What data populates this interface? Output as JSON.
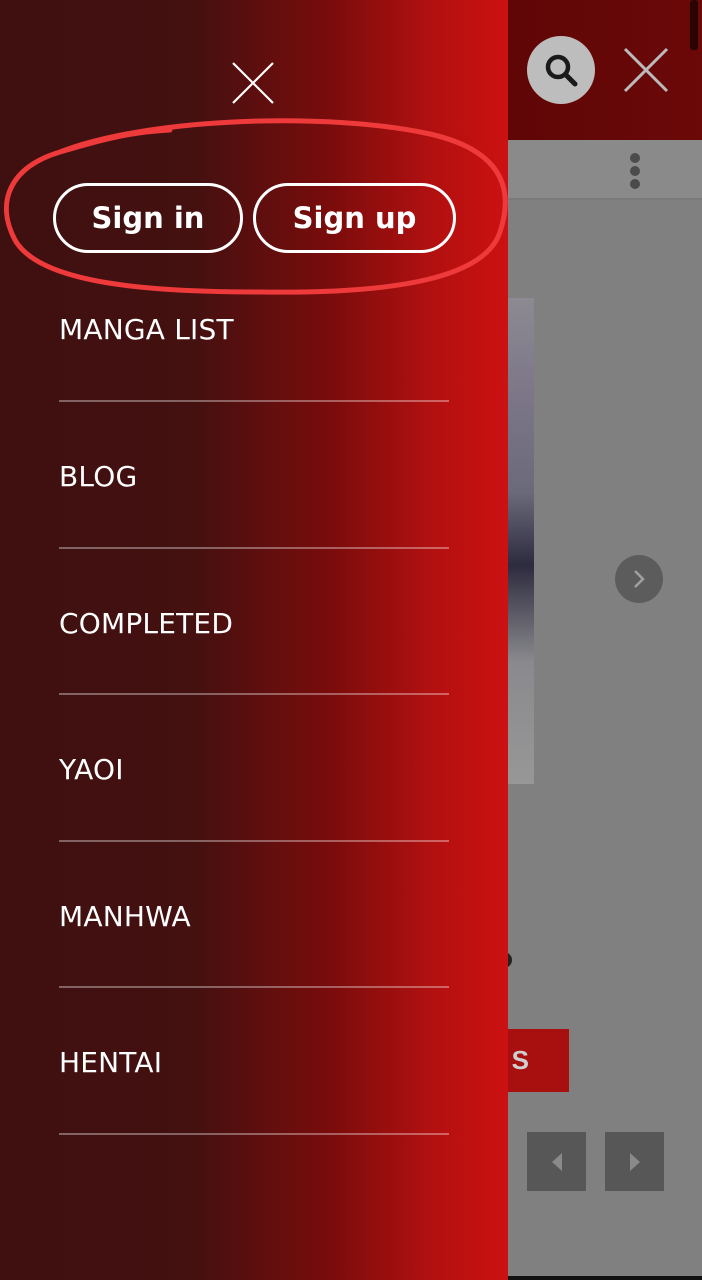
{
  "background_page": {
    "button_label": "S"
  },
  "drawer": {
    "auth": {
      "sign_in_label": "Sign in",
      "sign_up_label": "Sign up"
    },
    "menu_items": [
      {
        "label": "MANGA LIST"
      },
      {
        "label": "BLOG"
      },
      {
        "label": "COMPLETED"
      },
      {
        "label": "YAOI"
      },
      {
        "label": "MANHWA"
      },
      {
        "label": "HENTAI"
      }
    ]
  },
  "colors": {
    "drawer_dark": "#3f1010",
    "drawer_bright": "#cc1111",
    "annotation_red": "#ee3a3a",
    "overlay_gray": "#808080"
  },
  "icons": {
    "drawer_close": "close-icon",
    "search": "search-icon",
    "header_close": "close-icon",
    "more": "kebab-menu-icon",
    "carousel_next": "chevron-right-icon",
    "page_prev": "triangle-left-icon",
    "page_next": "triangle-right-icon"
  }
}
